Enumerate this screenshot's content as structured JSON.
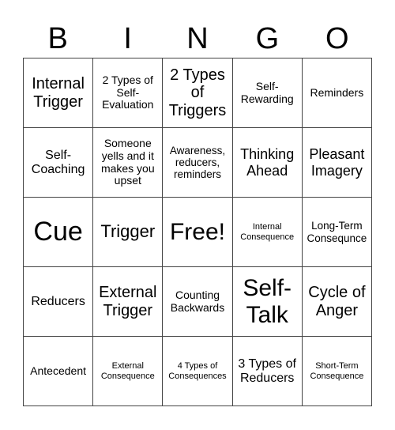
{
  "header": [
    "B",
    "I",
    "N",
    "G",
    "O"
  ],
  "cells": [
    {
      "text": "Internal Trigger",
      "size": "s20"
    },
    {
      "text": "2 Types of Self-Evaluation",
      "size": "s14"
    },
    {
      "text": "2 Types of Triggers",
      "size": "s20"
    },
    {
      "text": "Self-Rewarding",
      "size": "s14"
    },
    {
      "text": "Reminders",
      "size": "s14"
    },
    {
      "text": "Self-Coaching",
      "size": "s16"
    },
    {
      "text": "Someone yells and it makes you upset",
      "size": "s14"
    },
    {
      "text": "Awareness, reducers, reminders",
      "size": "s13"
    },
    {
      "text": "Thinking Ahead",
      "size": "s18"
    },
    {
      "text": "Pleasant Imagery",
      "size": "s18"
    },
    {
      "text": "Cue",
      "size": "s34"
    },
    {
      "text": "Trigger",
      "size": "s22"
    },
    {
      "text": "Free!",
      "size": "s30"
    },
    {
      "text": "Internal Consequence",
      "size": "s11"
    },
    {
      "text": "Long-Term Consequnce",
      "size": "s13"
    },
    {
      "text": "Reducers",
      "size": "s16"
    },
    {
      "text": "External Trigger",
      "size": "s20"
    },
    {
      "text": "Counting Backwards",
      "size": "s14"
    },
    {
      "text": "Self-Talk",
      "size": "s30"
    },
    {
      "text": "Cycle of Anger",
      "size": "s20"
    },
    {
      "text": "Antecedent",
      "size": "s14"
    },
    {
      "text": "External Consequence",
      "size": "s11"
    },
    {
      "text": "4 Types of Consequences",
      "size": "s11"
    },
    {
      "text": "3 Types of Reducers",
      "size": "s16"
    },
    {
      "text": "Short-Term Consequence",
      "size": "s11"
    }
  ]
}
